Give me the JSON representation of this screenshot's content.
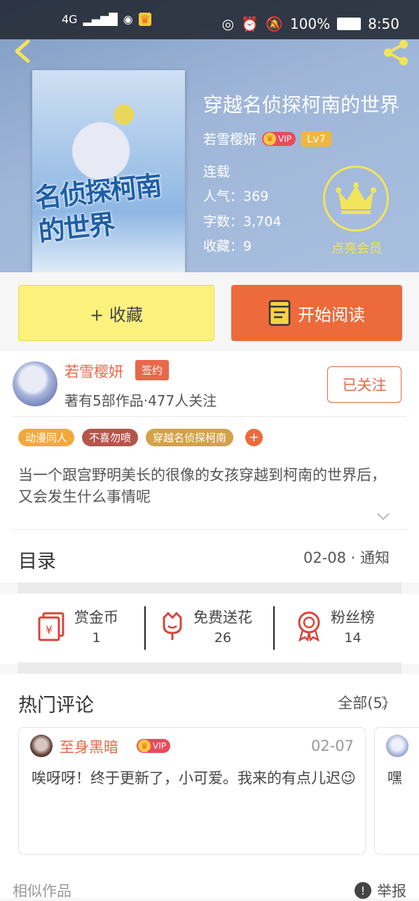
{
  "status_bar": {
    "signal": "4G",
    "battery": "100%",
    "time": "8:50"
  },
  "book": {
    "title": "穿越名侦探柯南的世界",
    "cover_title": "名侦探柯南的世界",
    "author": "若雪樱妍",
    "vip_label": "VIP",
    "level": "Lv7",
    "status": "连载",
    "popularity_label": "人气：",
    "popularity": "369",
    "words_label": "字数：",
    "words": "3,704",
    "favorites_label": "收藏：",
    "favorites": "9",
    "vip_cta": "点亮会员"
  },
  "actions": {
    "favorite": "+ 收藏",
    "read": "开始阅读"
  },
  "author_panel": {
    "name": "若雪樱妍",
    "signed": "签约",
    "summary": "著有5部作品·477人关注",
    "follow": "已关注"
  },
  "tags": [
    {
      "label": "动漫同人",
      "color": "#f2a93b"
    },
    {
      "label": "不喜勿喷",
      "color": "#b5554a"
    },
    {
      "label": "穿越名侦探柯南",
      "color": "#d2a24a"
    }
  ],
  "tag_add": "+",
  "description": "当一个跟宫野明美长的很像的女孩穿越到柯南的世界后，又会发生什么事情呢",
  "toc": {
    "label": "目录",
    "latest": "02-08 · 通知"
  },
  "rewards": [
    {
      "label": "赏金币",
      "count": "1",
      "icon": "red-envelope-icon"
    },
    {
      "label": "免费送花",
      "count": "26",
      "icon": "flower-icon"
    },
    {
      "label": "粉丝榜",
      "count": "14",
      "icon": "medal-icon"
    }
  ],
  "comments": {
    "label": "热门评论",
    "all": "全部(5)",
    "items": [
      {
        "user": "至身黑暗",
        "vip": "VIP",
        "date": "02-07",
        "text": "唉呀呀！终于更新了，小可爱。我来的有点儿迟😉"
      },
      {
        "text": "嘿"
      }
    ]
  },
  "footer": {
    "similar": "相似作品",
    "report": "举报",
    "report_icon": "!"
  },
  "colors": {
    "accent": "#ed6a3b",
    "author_red": "#e8684a",
    "fav_yellow": "#fbf17c",
    "crown_yellow": "#f2e45a"
  }
}
